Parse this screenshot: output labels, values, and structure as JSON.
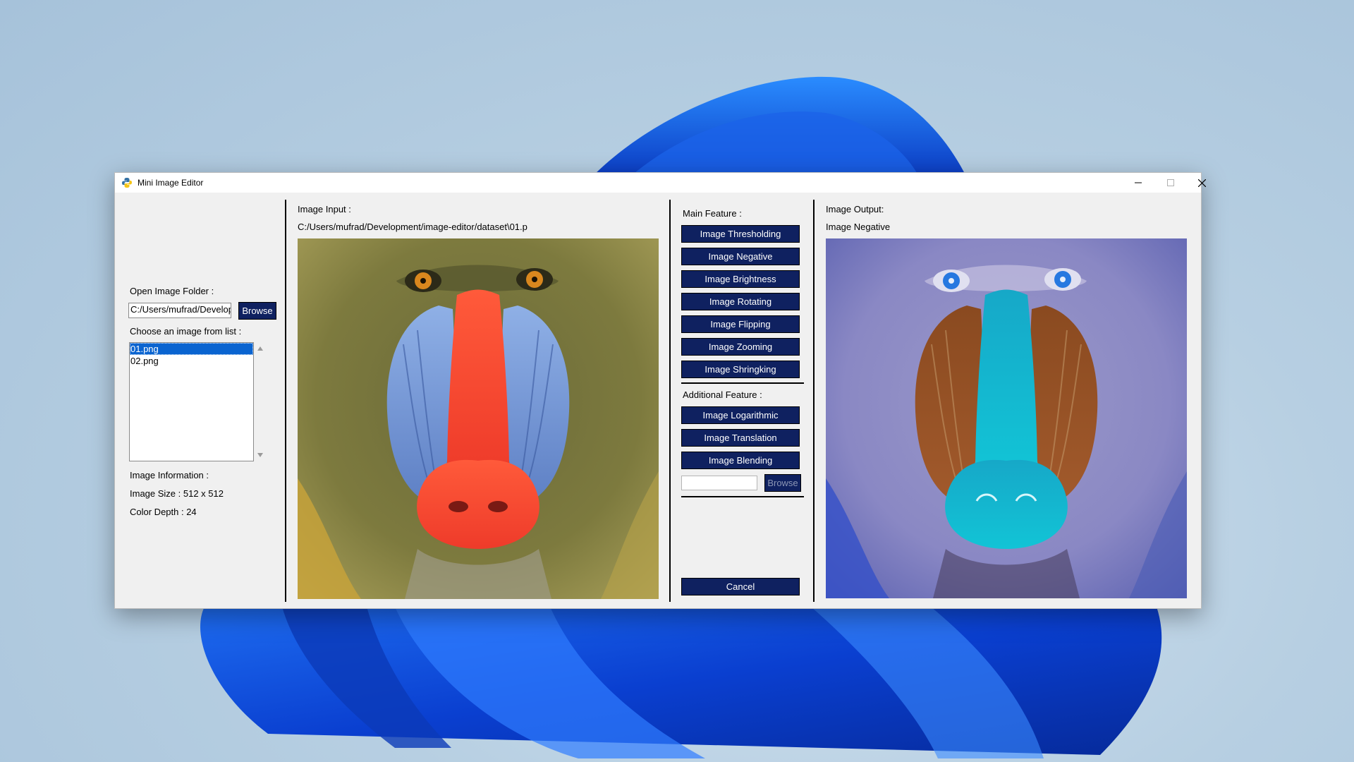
{
  "window": {
    "title": "Mini Image Editor",
    "controls": [
      "minimize-icon",
      "maximize-icon",
      "close-icon"
    ]
  },
  "left_panel": {
    "open_folder_label": "Open Image Folder :",
    "folder_path": "C:/Users/mufrad/Develop",
    "browse_label": "Browse",
    "choose_label": "Choose an image from list :",
    "files": [
      "01.png",
      "02.png"
    ],
    "selected_file": "01.png",
    "info_label": "Image Information :",
    "size_text": "Image Size : 512 x 512",
    "depth_text": "Color Depth : 24"
  },
  "input_panel": {
    "label": "Image Input :",
    "path": "C:/Users/mufrad/Development/image-editor/dataset\\01.p"
  },
  "features": {
    "main_label": "Main Feature :",
    "main_buttons": [
      "Image Thresholding",
      "Image Negative",
      "Image Brightness",
      "Image Rotating",
      "Image Flipping",
      "Image Zooming",
      "Image Shringking"
    ],
    "additional_label": "Additional Feature :",
    "additional_buttons": [
      "Image Logarithmic",
      "Image Translation",
      "Image Blending"
    ],
    "blend_path": "",
    "blend_browse_label": "Browse",
    "cancel_label": "Cancel"
  },
  "output_panel": {
    "label": "Image Output:",
    "operation": "Image Negative"
  },
  "colors": {
    "button_bg": "#0f2160",
    "selection": "#0a64d0",
    "window_bg": "#f0f0f0"
  }
}
